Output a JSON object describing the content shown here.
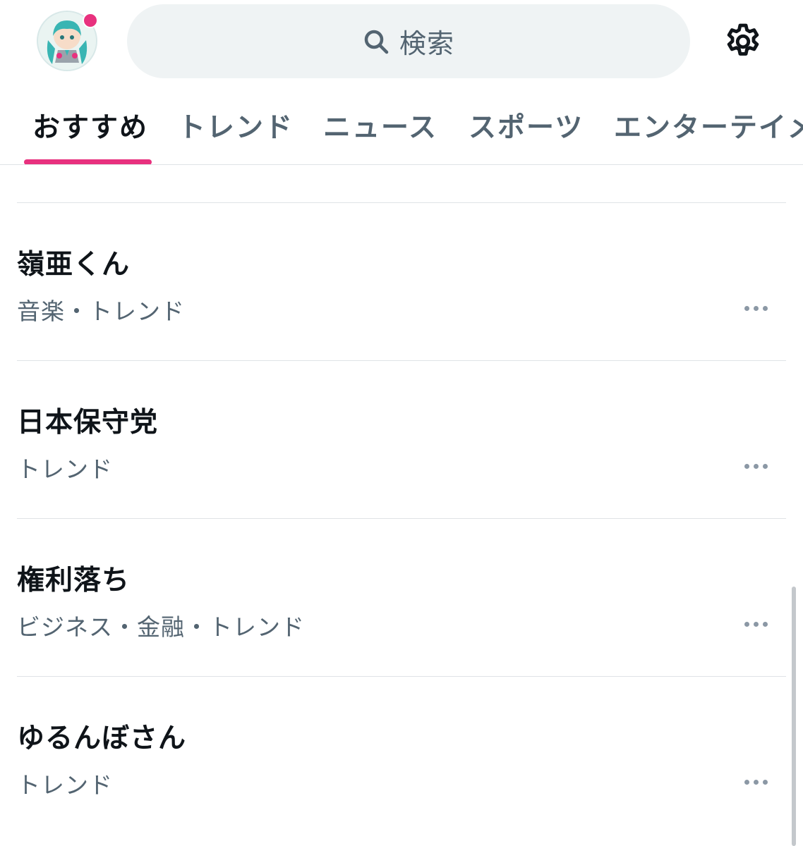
{
  "header": {
    "avatar_icon": "user-avatar-icon",
    "has_notification": true,
    "search": {
      "placeholder": "検索",
      "icon": "search-icon"
    },
    "settings_icon": "gear-icon"
  },
  "tabs": [
    {
      "label": "おすすめ",
      "active": true
    },
    {
      "label": "トレンド",
      "active": false
    },
    {
      "label": "ニュース",
      "active": false
    },
    {
      "label": "スポーツ",
      "active": false
    },
    {
      "label": "エンターテイメ",
      "active": false
    }
  ],
  "trends": [
    {
      "title": "嶺亜くん",
      "meta": "音楽・トレンド"
    },
    {
      "title": "日本保守党",
      "meta": "トレンド"
    },
    {
      "title": "権利落ち",
      "meta": "ビジネス・金融・トレンド"
    },
    {
      "title": "ゆるんぼさん",
      "meta": "トレンド"
    }
  ],
  "colors": {
    "accent": "#e8317e",
    "text_primary": "#0f1419",
    "text_secondary": "#536471",
    "search_bg": "#eff3f4",
    "divider": "#dfe3e6"
  }
}
